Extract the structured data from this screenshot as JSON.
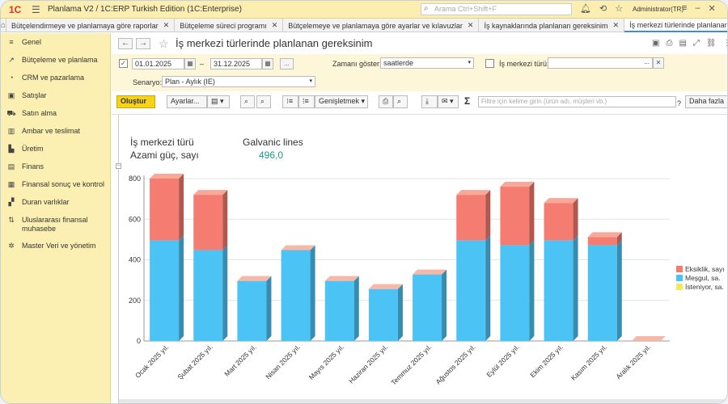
{
  "topbar": {
    "logo": "1C",
    "title": "Planlama V2 / 1C:ERP Turkish Edition  (1C:Enterprise)",
    "search_placeholder": "Arama Ctrl+Shift+F",
    "user": "Administrator(TR)"
  },
  "tabs": [
    {
      "label": "Bütçelendirmeye ve planlamaya göre raporlar",
      "active": false
    },
    {
      "label": "Bütçeleme süreci programı",
      "active": false
    },
    {
      "label": "Bütçelemeye ve planlamaya göre ayarlar ve kılavuzlar",
      "active": false
    },
    {
      "label": "İş kaynaklarında planlanan gereksinim",
      "active": false
    },
    {
      "label": "İş merkezi türlerinde planlanan gereksinim",
      "active": true
    }
  ],
  "sidebar": {
    "items": [
      {
        "icon": "≡",
        "label": "Genel"
      },
      {
        "icon": "↗",
        "label": "Bütçeleme ve planlama"
      },
      {
        "icon": "◔",
        "label": "CRM ve pazarlama"
      },
      {
        "icon": "▣",
        "label": "Satışlar"
      },
      {
        "icon": "⛟",
        "label": "Satın alma"
      },
      {
        "icon": "▥",
        "label": "Ambar ve teslimat"
      },
      {
        "icon": "▙",
        "label": "Üretim"
      },
      {
        "icon": "▤",
        "label": "Finans"
      },
      {
        "icon": "▦",
        "label": "Finansal sonuç ve kontrol"
      },
      {
        "icon": "▞",
        "label": "Duran varlıklar"
      },
      {
        "icon": "⇅",
        "label": "Uluslararası finansal muhasebe"
      },
      {
        "icon": "✲",
        "label": "Master Veri ve yönetim"
      }
    ]
  },
  "page": {
    "title": "İş merkezi türlerinde planlanan gereksinim"
  },
  "filters": {
    "date_from": "01.01.2025",
    "date_sep": "–",
    "date_to": "31.12.2025",
    "more": "...",
    "show_time_label": "Zamanı göster:",
    "show_time_value": "saatlerde",
    "wc_type_label": "İş merkezi türü:",
    "scenario_label": "Senaryo:",
    "scenario_value": "Plan - Aylık (IE)"
  },
  "toolbar": {
    "create": "Oluştur",
    "settings": "Ayarlar...",
    "expand": "Genişletmek",
    "sigma": "Σ",
    "filter_placeholder": "Filtre için kelime girin (ürün adı, müşteri vb.)",
    "help": "?",
    "more": "Daha fazla"
  },
  "chart_header": {
    "wc_type_label": "İş merkezi türü",
    "capacity_label": "Azami güç, sayı",
    "wc_type_value": "Galvanic lines",
    "capacity_value": "496,0"
  },
  "chart_data": {
    "type": "bar",
    "stacked": true,
    "categories": [
      "Ocak 2025 yıl.",
      "Şubat 2025 yıl.",
      "Mart 2025 yıl.",
      "Nisan 2025 yıl.",
      "Mayıs 2025 yıl.",
      "Haziran 2025 yıl.",
      "Temmuz 2025 yıl.",
      "Ağustos 2025 yıl.",
      "Eylül 2025 yıl.",
      "Ekim 2025 yıl.",
      "Kasım 2025 yıl.",
      "Aralık 2025 yıl."
    ],
    "series": [
      {
        "name": "Meşgul, sa.",
        "color": "#4cc3f5",
        "values": [
          496,
          448,
          296,
          448,
          296,
          256,
          328,
          496,
          472,
          496,
          472,
          0
        ]
      },
      {
        "name": "Eksiklik, sayı",
        "color": "#f47c70",
        "values": [
          304,
          272,
          0,
          0,
          0,
          0,
          0,
          224,
          288,
          184,
          40,
          0
        ]
      },
      {
        "name": "İsteniyor, sa.",
        "color": "#f2ea5a",
        "values": [
          0,
          0,
          0,
          0,
          0,
          0,
          0,
          0,
          0,
          0,
          0,
          0
        ]
      }
    ],
    "yticks": [
      "0",
      "200",
      "400",
      "600",
      "800"
    ],
    "ylim": [
      0,
      800
    ],
    "grid": true,
    "legend_position": "right"
  }
}
